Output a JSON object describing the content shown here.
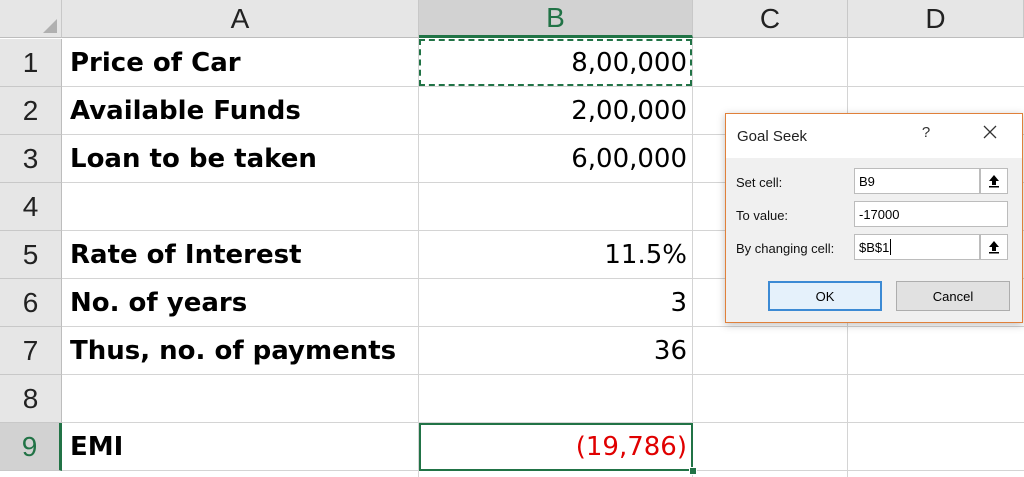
{
  "columns": [
    "A",
    "B",
    "C",
    "D"
  ],
  "rows": [
    "1",
    "2",
    "3",
    "4",
    "5",
    "6",
    "7",
    "8",
    "9"
  ],
  "cells": {
    "A1": "Price of Car",
    "B1": "8,00,000",
    "A2": "Available Funds",
    "B2": "2,00,000",
    "A3": "Loan to be taken",
    "B3": "6,00,000",
    "A5": "Rate of Interest",
    "B5": "11.5%",
    "A6": "No. of years",
    "B6": "3",
    "A7": "Thus, no. of payments",
    "B7": "36",
    "A9": "EMI",
    "B9": "(19,786)"
  },
  "colors": {
    "excel_green": "#217346",
    "negative_red": "#e00000",
    "dialog_border": "#e0803a",
    "ok_button_border": "#3c8ad4"
  },
  "dialog": {
    "title": "Goal Seek",
    "help": "?",
    "close_icon": "close-icon",
    "set_cell_label": "Set cell:",
    "set_cell_value": "B9",
    "to_value_label": "To value:",
    "to_value_value": "-17000",
    "changing_cell_label": "By changing cell:",
    "changing_cell_value": "$B$1",
    "ok": "OK",
    "cancel": "Cancel",
    "ref_icon": "collapse-dialog-icon"
  }
}
